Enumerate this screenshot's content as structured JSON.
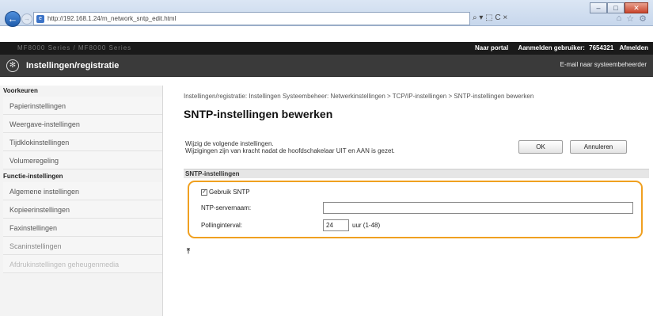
{
  "browser": {
    "url": "http://192.168.1.24/m_network_sntp_edit.html",
    "address_tools": "⌕ ▾ ⬚ C ×",
    "window_buttons": [
      "–",
      "□",
      "✕"
    ],
    "right_icons": [
      "⌂",
      "☆",
      "⚙"
    ]
  },
  "device": {
    "model": "MF8000 Series / MF8000 Series",
    "portal": "Naar portal",
    "login_label": "Aanmelden gebruiker:",
    "user_id": "7654321",
    "logout": "Afmelden",
    "section_title": "Instellingen/registratie",
    "admin_mail": "E-mail naar systeembeheerder"
  },
  "sidebar": {
    "preferences_header": "Voorkeuren",
    "preferences": [
      "Papierinstellingen",
      "Weergave-instellingen",
      "Tijdklokinstellingen",
      "Volumeregeling"
    ],
    "functions_header": "Functie-instellingen",
    "functions": [
      "Algemene instellingen",
      "Kopieerinstellingen",
      "Faxinstellingen",
      "Scaninstellingen",
      "Afdrukinstellingen geheugenmedia"
    ]
  },
  "main": {
    "breadcrumb": "Instellingen/registratie: Instellingen Systeembeheer: Netwerkinstellingen > TCP/IP-instellingen > SNTP-instellingen bewerken",
    "title": "SNTP-instellingen bewerken",
    "desc_line1": "Wijzig de volgende instellingen.",
    "desc_line2": "Wijzigingen zijn van kracht nadat de hoofdschakelaar UIT en AAN is gezet.",
    "ok_label": "OK",
    "cancel_label": "Annuleren",
    "section_title": "SNTP-instellingen",
    "use_sntp_label": "Gebruik SNTP",
    "use_sntp_checked": true,
    "ntp_server_label": "NTP-servernaam:",
    "ntp_server_value": "",
    "polling_label": "Pollinginterval:",
    "polling_value": "24",
    "polling_unit": "uur (1-48)",
    "top_link": "⤒"
  }
}
